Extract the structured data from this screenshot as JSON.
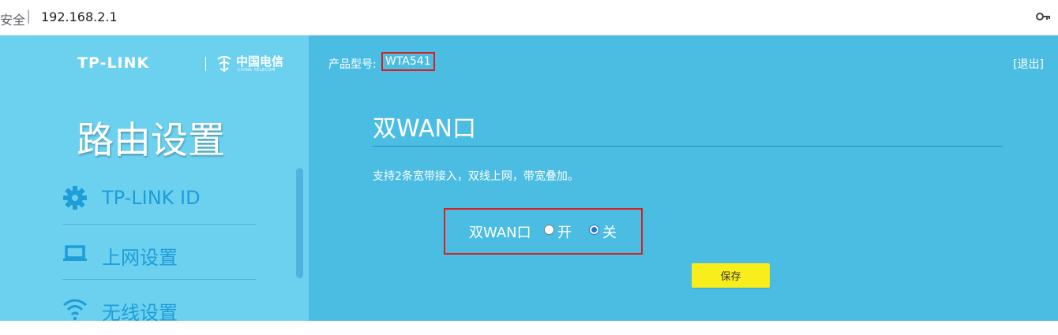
{
  "browser": {
    "security_label": "安全",
    "separator": "|",
    "url": "192.168.2.1",
    "key_icon": "key-icon"
  },
  "brand": {
    "tplink": "TP-LINK",
    "separator": "|",
    "partner_cn": "中国电信",
    "partner_en": "CHINA TELECOM"
  },
  "sidebar": {
    "title": "路由设置",
    "items": [
      {
        "label": "TP-LINK ID",
        "icon": "gear-icon"
      },
      {
        "label": "上网设置",
        "icon": "laptop-icon"
      },
      {
        "label": "无线设置",
        "icon": "wifi-icon"
      }
    ]
  },
  "header": {
    "model_label": "产品型号:",
    "model_value": "WTA541",
    "logout": "[退出]"
  },
  "main": {
    "title": "双WAN口",
    "description": "支持2条宽带接入，双线上网，带宽叠加。",
    "option": {
      "label": "双WAN口",
      "choices": [
        {
          "label": "开",
          "checked": false
        },
        {
          "label": "关",
          "checked": true
        }
      ]
    },
    "save_label": "保存"
  },
  "colors": {
    "sidebar_bg": "#6cd0ef",
    "main_bg": "#4bbde2",
    "menu_text": "#1e9dd9",
    "highlight_border": "#d72020",
    "save_button": "#f8ee1c"
  }
}
